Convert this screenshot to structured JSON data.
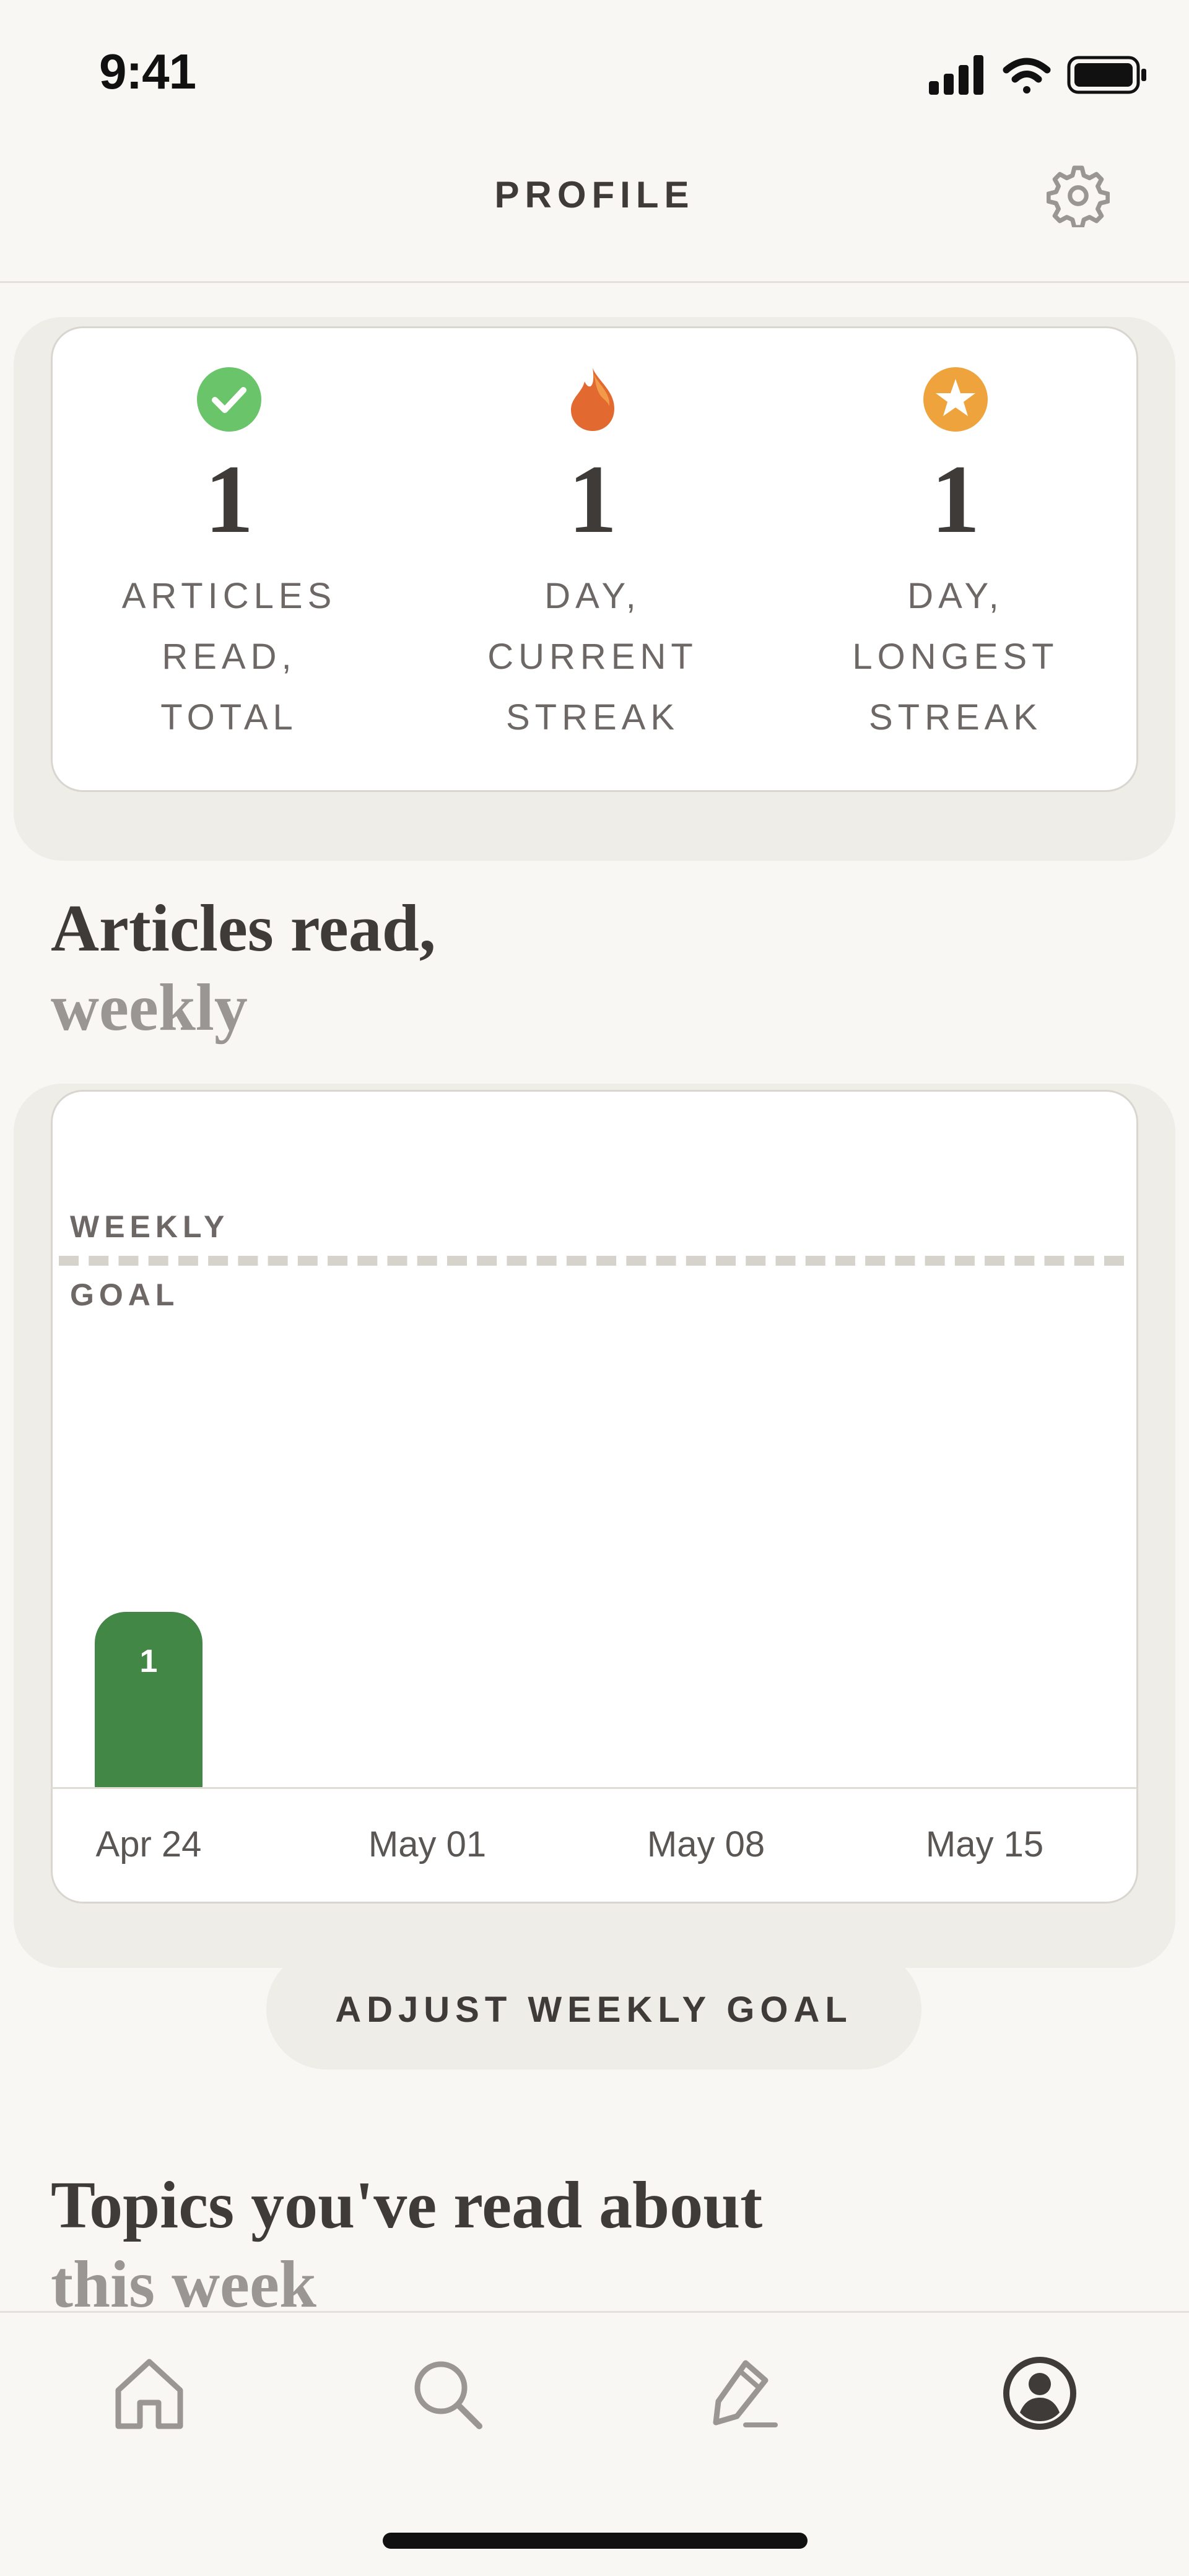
{
  "status_bar": {
    "time": "9:41"
  },
  "header": {
    "title": "PROFILE"
  },
  "stats": [
    {
      "icon": "checkmark-circle-icon",
      "value": "1",
      "label_lines": [
        "ARTICLES",
        "READ,",
        "TOTAL"
      ]
    },
    {
      "icon": "flame-icon",
      "value": "1",
      "label_lines": [
        "DAY,",
        "CURRENT",
        "STREAK"
      ]
    },
    {
      "icon": "star-badge-icon",
      "value": "1",
      "label_lines": [
        "DAY,",
        "LONGEST",
        "STREAK"
      ]
    }
  ],
  "weekly_section": {
    "title": "Articles read,",
    "subtitle": "weekly"
  },
  "chart_data": {
    "type": "bar",
    "categories": [
      "Apr 24",
      "May 01",
      "May 08",
      "May 15"
    ],
    "values": [
      1,
      0,
      0,
      0
    ],
    "data_labels": [
      "1",
      "",
      "",
      ""
    ],
    "goal_label_top": "WEEKLY",
    "goal_label_bottom": "GOAL",
    "goal_value": 3,
    "ylim": [
      0,
      4
    ],
    "color": "#428746",
    "grid": false
  },
  "adjust_button": {
    "label": "ADJUST WEEKLY GOAL"
  },
  "topics_section": {
    "title": "Topics you've read about",
    "subtitle": "this week"
  },
  "tab_bar": {
    "items": [
      {
        "icon": "home-icon",
        "active": false
      },
      {
        "icon": "search-icon",
        "active": false
      },
      {
        "icon": "pen-icon",
        "active": false
      },
      {
        "icon": "profile-icon",
        "active": true
      }
    ]
  },
  "colors": {
    "background": "#f8f7f3",
    "text": "#3f3b39",
    "muted": "#9a9693",
    "bar": "#428746",
    "check": "#6ac46a",
    "flame": "#e2692f",
    "star": "#eea33d"
  }
}
